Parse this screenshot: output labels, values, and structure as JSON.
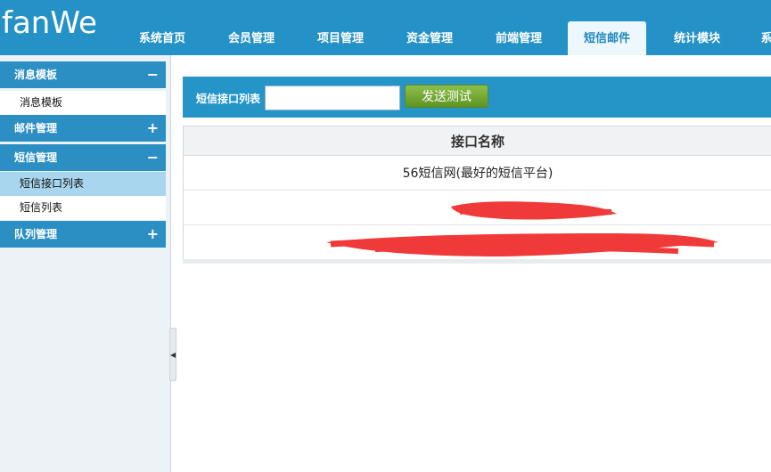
{
  "logo": {
    "text": "fanWe"
  },
  "nav": {
    "items": [
      {
        "label": "系统首页",
        "active": false
      },
      {
        "label": "会员管理",
        "active": false
      },
      {
        "label": "项目管理",
        "active": false
      },
      {
        "label": "资金管理",
        "active": false
      },
      {
        "label": "前端管理",
        "active": false
      },
      {
        "label": "短信邮件",
        "active": true
      },
      {
        "label": "统计模块",
        "active": false
      },
      {
        "label": "系",
        "active": false
      }
    ]
  },
  "sidebar": {
    "groups": [
      {
        "label": "消息模板",
        "sign": "−",
        "items": [
          {
            "label": "消息模板"
          }
        ]
      },
      {
        "label": "邮件管理",
        "sign": "+",
        "items": []
      },
      {
        "label": "短信管理",
        "sign": "−",
        "items": [
          {
            "label": "短信接口列表",
            "active": true
          },
          {
            "label": "短信列表"
          }
        ]
      },
      {
        "label": "队列管理",
        "sign": "+",
        "items": []
      }
    ]
  },
  "toolbar": {
    "label": "短信接口列表",
    "input_value": "",
    "send_test_label": "发送测试"
  },
  "table": {
    "header": "接口名称",
    "rows": [
      {
        "name": "56短信网(最好的短信平台)"
      },
      {
        "name": "",
        "redacted": true
      },
      {
        "name": "",
        "redacted": true
      }
    ]
  },
  "colors": {
    "header_blue": "#2492c6",
    "sidebar_head": "#2c8fc4",
    "active_item": "#a7d6ee",
    "send_button": "#6fa52e",
    "redaction": "#f03a3a"
  }
}
